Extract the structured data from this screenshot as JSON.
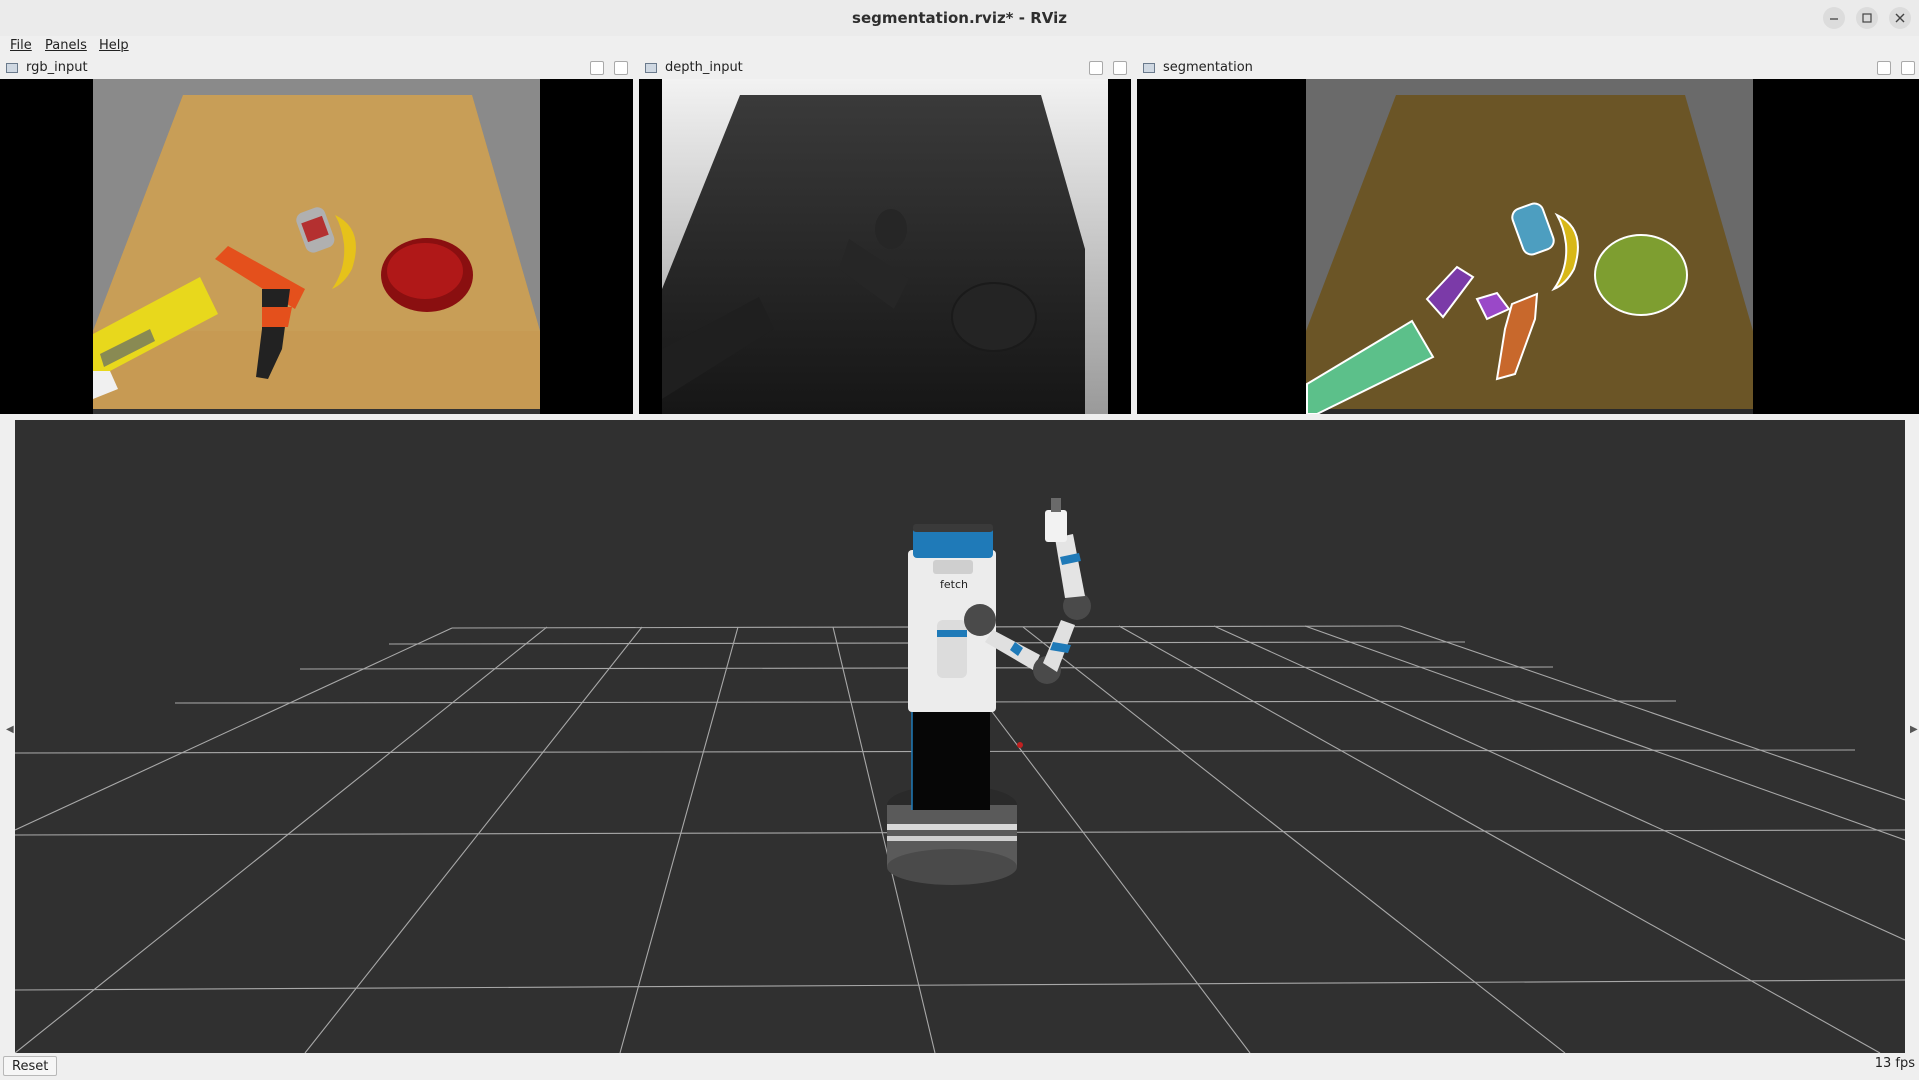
{
  "window": {
    "title": "segmentation.rviz* - RViz"
  },
  "menu": {
    "items": [
      "File",
      "Panels",
      "Help"
    ]
  },
  "panels": [
    {
      "title": "rgb_input",
      "icon": "image-panel-icon"
    },
    {
      "title": "depth_input",
      "icon": "image-panel-icon"
    },
    {
      "title": "segmentation",
      "icon": "image-panel-icon"
    }
  ],
  "robot": {
    "logo_text": "fetch"
  },
  "status": {
    "reset_label": "Reset",
    "fps": "13 fps"
  },
  "colors": {
    "background_3d": "#303030",
    "grid": "#a8a8a8",
    "table_wood": "#c79a53",
    "robot_blue": "#1f7ab8"
  }
}
